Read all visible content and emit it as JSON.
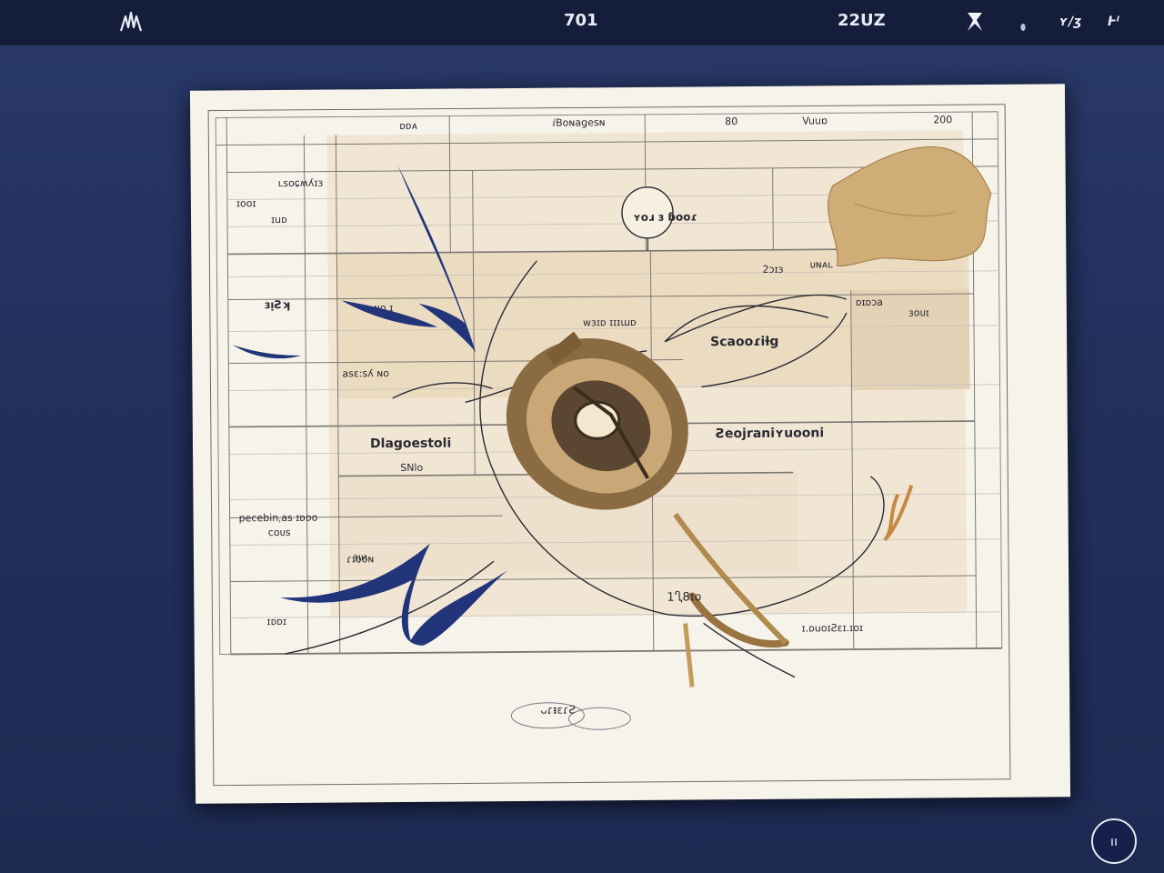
{
  "topbar": {
    "left_icon": "wave-logo-icon",
    "center_title": "701",
    "right_title": "22UZ",
    "icons": [
      "pin-icon",
      "dot-icon",
      "wrench-icon",
      "grid-icon"
    ],
    "icon_labels": [
      "",
      "",
      "ʏ∕ʒ",
      "Ͱᴵ"
    ]
  },
  "diagram": {
    "header_cells": [
      "ᴅᴅᴀ",
      "ⅈBoɴagesɴ",
      "80",
      "Vuuɒ",
      "200"
    ],
    "left_labels": [
      "ʟsoɕʍʎɪɜ",
      "ɪooɪ",
      "ɪuᴅ",
      "ɜᴉƧʞ",
      "ᴅ ɴo ɪ",
      "asɛ:sʎ ɴo",
      "pecebinˌas ɪᴅᴅo",
      "ᴄoᴜs",
      "ɪᴅᴅɪ",
      "ɜᴉᴎ"
    ],
    "center_node": "ʏoɹ ɜ ɓooɾ",
    "labels": {
      "sbaa": "ᴅɪᴅɔa",
      "link_a": "ᴡɜɪᴅ ɪɪɪɯᴅ",
      "link_b": "2ɔɪɜ",
      "link_c": "ᴜɴᴀʟ",
      "spooil": "ɜoᴜɪ",
      "scooring": "Scaooɾiƚg",
      "diagnostic": "Dlagoestoli",
      "diagnostic_sub": "SNlo",
      "storage": "Ƨeojraniʏuooni",
      "eoon": "ɾɪooɴ",
      "year": "1Ⴂ8ɪo",
      "bottom_right": "ɪ.ᴅuᴏɪƧɛɪ.ɪoɪ",
      "signature": "ᴗɾᵻɛɾƧ"
    }
  },
  "fab": {
    "label": "ıı"
  },
  "colors": {
    "background": "#22305c",
    "topbar": "#141d3a",
    "paper": "#f6f3ea",
    "panel": "#efe2cc",
    "ink": "#2b2a33",
    "accent_blue": "#23357a",
    "accent_brass": "#b08a4e"
  }
}
